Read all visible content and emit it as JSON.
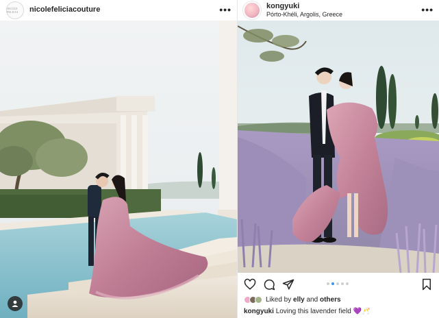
{
  "left_post": {
    "username": "nicolefeliciacouture",
    "avatar_text": "NICOLE FELICIA",
    "more_label": "•••"
  },
  "right_post": {
    "username": "kongyuki",
    "location": "Pórto-Khéli, Argolis, Greece",
    "more_label": "•••",
    "likes": {
      "prefix": "Liked by",
      "user": "elly",
      "middle": "and",
      "others": "others"
    },
    "caption": {
      "user": "kongyuki",
      "text": "Loving this lavender field 💜🥂"
    }
  },
  "icons": {
    "heart": "heart-icon",
    "comment": "comment-icon",
    "share": "share-icon",
    "save": "bookmark-icon",
    "user_tag": "user-tag-icon"
  },
  "carousel": {
    "count": 5,
    "active_index": 1
  },
  "colors": {
    "dress": "#c07e95",
    "lavender": "#a99ac4",
    "pool": "#8fc3cf",
    "sky": "#eef1f2",
    "carousel_active": "#3797f0"
  }
}
